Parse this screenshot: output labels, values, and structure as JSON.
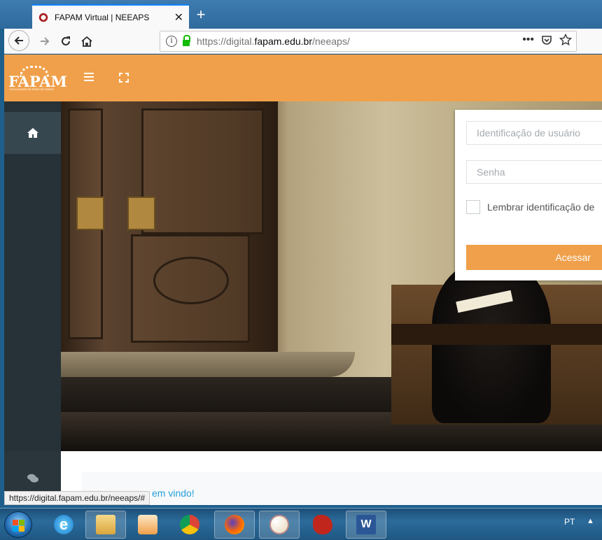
{
  "browser": {
    "tab_title": "FAPAM Virtual | NEEAPS",
    "tab_close": "✕",
    "new_tab": "+",
    "url_prefix": "https://digital.",
    "url_domain": "fapam.edu.br",
    "url_path": "/neeaps/",
    "page_actions": "•••",
    "status_url": "https://digital.fapam.edu.br/neeaps/#"
  },
  "site": {
    "logo_text": "FAPAM",
    "logo_subtext": "FACULDADE DE PARÁ DE MINAS",
    "accent_color": "#f0a04a",
    "sidebar_color": "#263238"
  },
  "login": {
    "username_placeholder": "Identificação de usuário",
    "password_placeholder": "Senha",
    "remember_label": "Lembrar identificação de",
    "submit_label": "Acessar"
  },
  "content": {
    "welcome_text": "em vindo!"
  },
  "taskbar": {
    "language": "PT",
    "apps": [
      "windows-start",
      "internet-explorer",
      "file-explorer",
      "media-player",
      "chrome",
      "firefox",
      "paint",
      "game",
      "word"
    ]
  }
}
